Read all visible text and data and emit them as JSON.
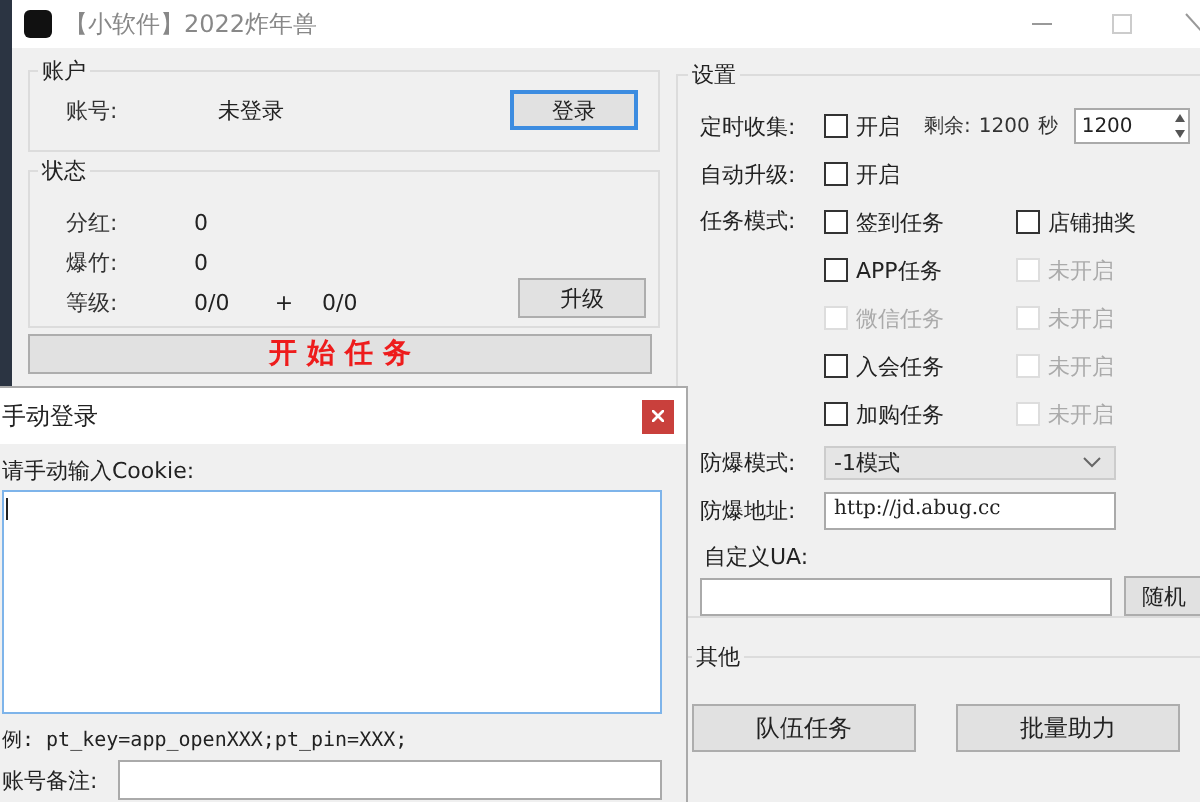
{
  "window": {
    "title": "【小软件】2022炸年兽"
  },
  "account": {
    "title": "账户",
    "label": "账号:",
    "value": "未登录",
    "button": "登录"
  },
  "status": {
    "title": "状态",
    "rows": [
      {
        "label": "分红:",
        "value": "0"
      },
      {
        "label": "爆竹:",
        "value": "0"
      },
      {
        "label": "等级:",
        "value": "0/0",
        "plus": "+",
        "extra": "0/0"
      }
    ],
    "button": "升级"
  },
  "start_button": "开 始 任 务",
  "settings": {
    "title": "设置",
    "timer": {
      "label": "定时收集:",
      "checkbox": {
        "label": "开启",
        "checked": false
      },
      "remaining_label": "剩余:",
      "remaining": "1200",
      "unit": "秒",
      "spin_value": "1200"
    },
    "auto_upgrade": {
      "label": "自动升级:",
      "checkbox": {
        "label": "开启",
        "checked": false
      }
    },
    "task_mode": {
      "label": "任务模式:",
      "options": [
        {
          "label": "签到任务",
          "checked": false,
          "disabled": false
        },
        {
          "label": "店铺抽奖",
          "checked": false,
          "disabled": false
        },
        {
          "label": "APP任务",
          "checked": false,
          "disabled": false
        },
        {
          "label": "未开启",
          "checked": false,
          "disabled": true
        },
        {
          "label": "微信任务",
          "checked": false,
          "disabled": true
        },
        {
          "label": "未开启",
          "checked": false,
          "disabled": true
        },
        {
          "label": "入会任务",
          "checked": false,
          "disabled": false
        },
        {
          "label": "未开启",
          "checked": false,
          "disabled": true
        },
        {
          "label": "加购任务",
          "checked": false,
          "disabled": false
        },
        {
          "label": "未开启",
          "checked": false,
          "disabled": true
        }
      ]
    },
    "anti_mode": {
      "label": "防爆模式:",
      "value": "-1模式"
    },
    "anti_url": {
      "label": "防爆地址:",
      "value": "http://jd.abug.cc"
    },
    "ua": {
      "label": "自定义UA:",
      "button": "随机"
    }
  },
  "other": {
    "title": "其他",
    "buttons": [
      "队伍任务",
      "批量助力"
    ]
  },
  "dialog": {
    "title": "手动登录",
    "prompt": "请手动输入Cookie:",
    "example": "例: pt_key=app_openXXX;pt_pin=XXX;",
    "note_label": "账号备注:"
  }
}
